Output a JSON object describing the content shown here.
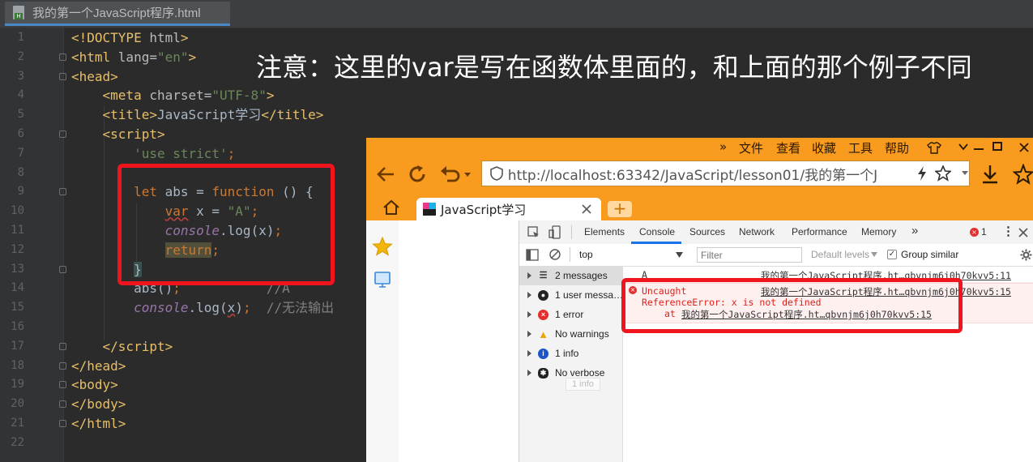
{
  "editor": {
    "tab_title": "我的第一个JavaScript程序.html",
    "line_numbers": [
      "1",
      "2",
      "3",
      "4",
      "5",
      "6",
      "7",
      "8",
      "9",
      "10",
      "11",
      "12",
      "13",
      "14",
      "15",
      "16",
      "17",
      "18",
      "19",
      "20",
      "21",
      "22"
    ]
  },
  "annotation": "注意：这里的var是写在函数体里面的，和上面的那个例子不同",
  "browser": {
    "menu": [
      "文件",
      "查看",
      "收藏",
      "工具",
      "帮助"
    ],
    "menu_chevrons": "»",
    "url": "http://localhost:63342/JavaScript/lesson01/我的第一个J",
    "tab_title": "JavaScript学习",
    "new_tab": "+",
    "devtools": {
      "tabs": [
        "Elements",
        "Console",
        "Sources",
        "Network",
        "Performance",
        "Memory"
      ],
      "more_tabs": "»",
      "error_count": "1",
      "context": "top",
      "filter_placeholder": "Filter",
      "levels": "Default levels",
      "group_similar": "Group similar",
      "sidebar": [
        {
          "label": "2 messages",
          "icon": "list-icon"
        },
        {
          "label": "1 user messa…",
          "icon": "user-icon"
        },
        {
          "label": "1 error",
          "icon": "error-icon"
        },
        {
          "label": "No warnings",
          "icon": "warning-icon"
        },
        {
          "label": "1 info",
          "icon": "info-icon"
        },
        {
          "label": "No verbose",
          "icon": "bug-icon"
        }
      ],
      "tooltip": "1 info",
      "log": {
        "value": "A",
        "source": "我的第一个JavaScript程序.ht…qbvnjm6j0h70kvv5:11"
      },
      "error": {
        "title": "Uncaught",
        "source": "我的第一个JavaScript程序.ht…qbvnjm6j0h70kvv5:15",
        "message": "ReferenceError: x is not defined",
        "at_prefix": "at ",
        "at_link": "我的第一个JavaScript程序.ht…qbvnjm6j0h70kvv5:15"
      }
    }
  },
  "colors": {
    "editor_bg": "#2b2b2b",
    "browser_orange": "#f89b1e",
    "highlight_red": "#f0141e",
    "error_text": "#e0201a"
  }
}
